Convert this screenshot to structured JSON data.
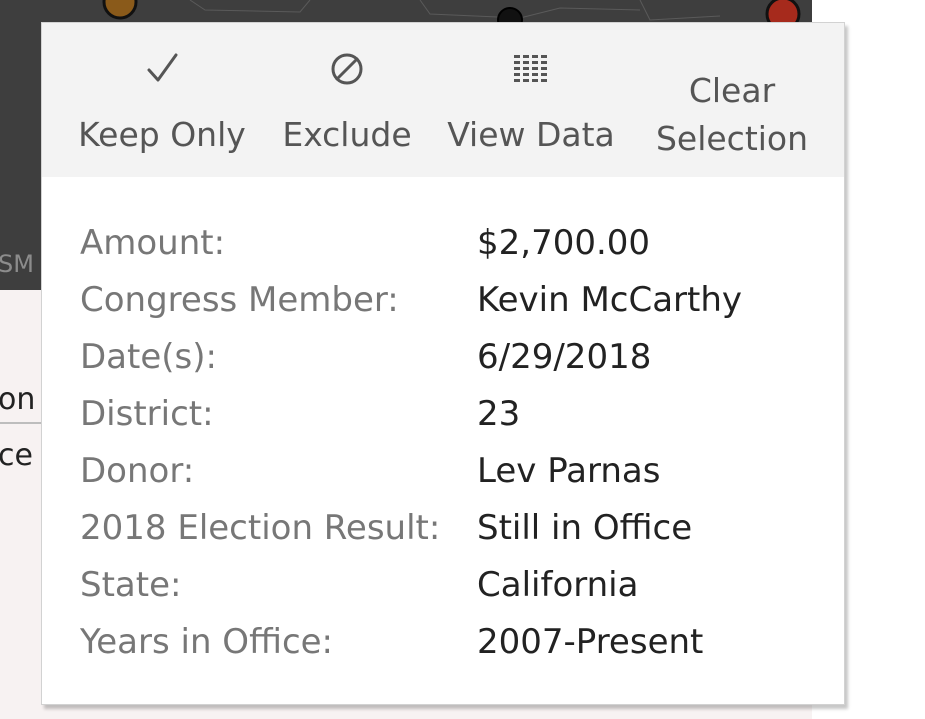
{
  "background": {
    "map_corner_label": "SM",
    "left_text_1": "on",
    "left_text_2": "ce"
  },
  "toolbar": {
    "keep_only": {
      "label": "Keep Only",
      "icon": "checkmark-icon"
    },
    "exclude": {
      "label": "Exclude",
      "icon": "no-entry-icon"
    },
    "view_data": {
      "label": "View Data",
      "icon": "grid-icon"
    },
    "clear_selection": {
      "label": "Clear Selection",
      "icon": ""
    }
  },
  "fields": [
    {
      "label": "Amount:",
      "value": "$2,700.00"
    },
    {
      "label": "Congress Member:",
      "value": "Kevin McCarthy"
    },
    {
      "label": "Date(s):",
      "value": "6/29/2018"
    },
    {
      "label": "District:",
      "value": "23"
    },
    {
      "label": "Donor:",
      "value": "Lev Parnas"
    },
    {
      "label": "2018 Election Result:",
      "value": "Still in Office"
    },
    {
      "label": "State:",
      "value": "California"
    },
    {
      "label": "Years in Office:",
      "value": "2007-Present"
    }
  ],
  "colors": {
    "toolbar_bg": "#f3f3f3",
    "label_text": "#777777",
    "value_text": "#222222",
    "map_bg": "#3e3e3e",
    "marker_orange": "#b5651d",
    "marker_red": "#a62a1c"
  }
}
